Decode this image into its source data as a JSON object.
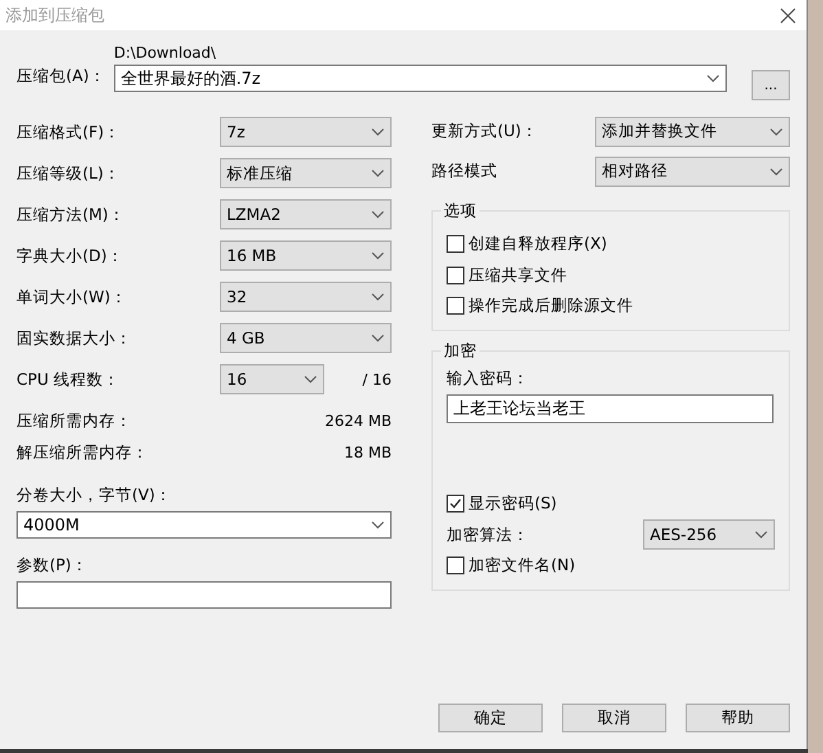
{
  "window": {
    "title": "添加到压缩包"
  },
  "archive": {
    "label": "压缩包(A)：",
    "path": "D:\\Download\\",
    "value": "全世界最好的酒.7z",
    "browse_button": "..."
  },
  "left_options": [
    {
      "label": "压缩格式(F)：",
      "value": "7z",
      "kind": "combo"
    },
    {
      "label": "压缩等级(L)：",
      "value": "标准压缩",
      "kind": "combo"
    },
    {
      "label": "压缩方法(M)：",
      "value": "LZMA2",
      "kind": "combo"
    },
    {
      "label": "字典大小(D)：",
      "value": "16 MB",
      "kind": "combo"
    },
    {
      "label": "单词大小(W)：",
      "value": "32",
      "kind": "combo"
    },
    {
      "label": "固实数据大小：",
      "value": "4 GB",
      "kind": "combo"
    },
    {
      "label": "CPU 线程数：",
      "value": "16",
      "kind": "short-combo",
      "suffix": "/ 16"
    }
  ],
  "memory": [
    {
      "label": "压缩所需内存：",
      "value": "2624 MB"
    },
    {
      "label": "解压缩所需内存：",
      "value": "18 MB"
    }
  ],
  "volume": {
    "label": "分卷大小，字节(V)：",
    "value": "4000M"
  },
  "parameters": {
    "label": "参数(P)："
  },
  "right_options": [
    {
      "label": "更新方式(U)：",
      "value": "添加并替换文件"
    },
    {
      "label": "路径模式",
      "value": "相对路径"
    }
  ],
  "options_group": {
    "title": "选项",
    "items": [
      {
        "label": "创建自释放程序(X)",
        "checked": false
      },
      {
        "label": "压缩共享文件",
        "checked": false
      },
      {
        "label": "操作完成后删除源文件",
        "checked": false
      }
    ]
  },
  "encryption": {
    "title": "加密",
    "password_label": "输入密码：",
    "password": "上老王论坛当老王",
    "show_password": {
      "label": "显示密码(S)",
      "checked": true
    },
    "method": {
      "label": "加密算法：",
      "value": "AES-256"
    },
    "encrypt_names": {
      "label": "加密文件名(N)",
      "checked": false
    }
  },
  "buttons": [
    "确定",
    "取消",
    "帮助"
  ]
}
